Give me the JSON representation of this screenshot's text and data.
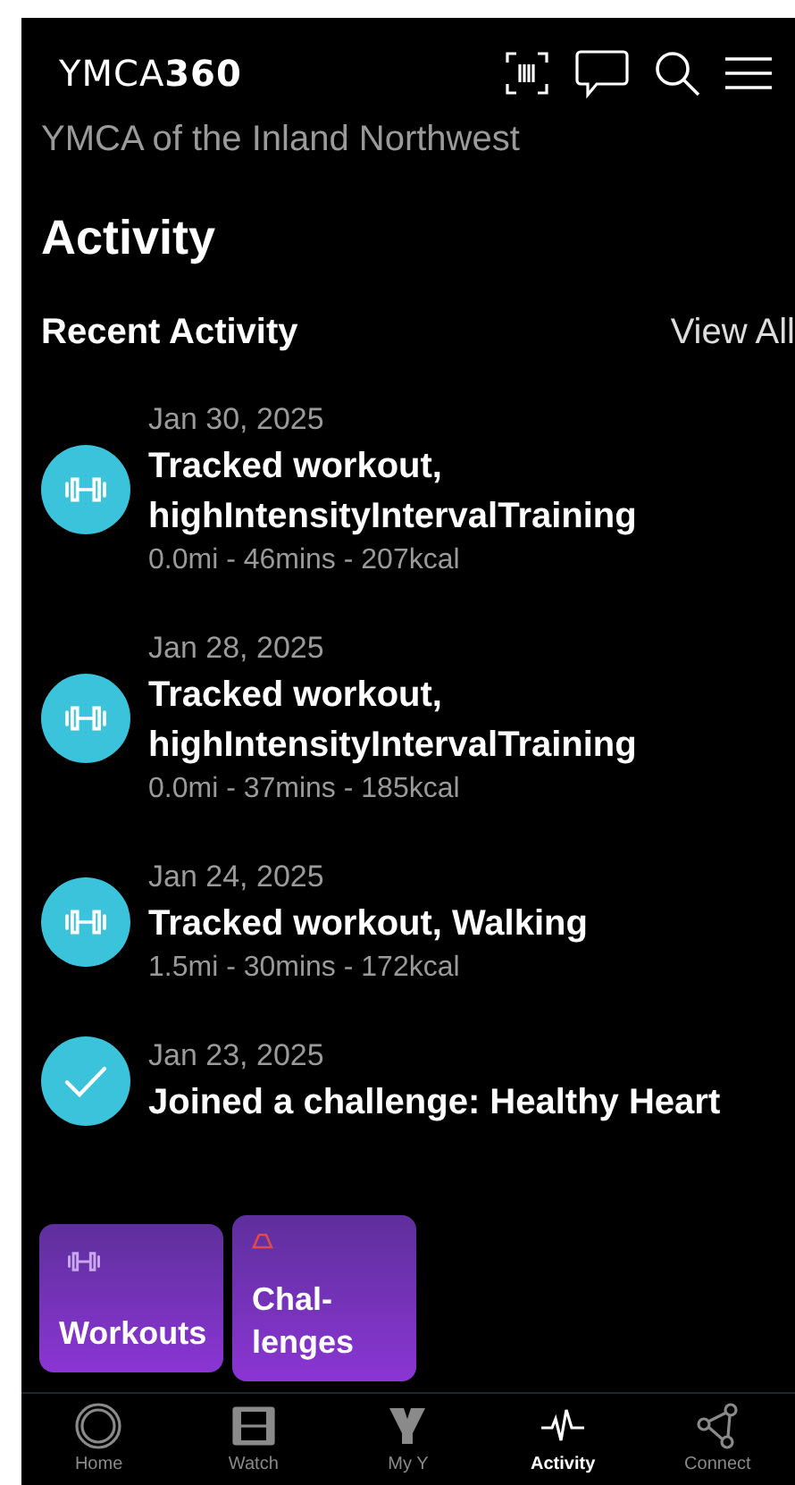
{
  "header": {
    "logo_text": "YMCA",
    "logo_number": "360",
    "subtitle": "YMCA of the Inland Northwest"
  },
  "page_title": "Activity",
  "section": {
    "title": "Recent Activity",
    "link": "View All"
  },
  "activities": [
    {
      "kind": "workout",
      "date": "Jan 30, 2025",
      "title": "Tracked workout, highIntensityIntervalTraining",
      "stats": "0.0mi - 46mins - 207kcal"
    },
    {
      "kind": "workout",
      "date": "Jan 28, 2025",
      "title": "Tracked workout, highIntensityIntervalTraining",
      "stats": "0.0mi - 37mins - 185kcal"
    },
    {
      "kind": "workout",
      "date": "Jan 24, 2025",
      "title": "Tracked workout, Walking",
      "stats": "1.5mi - 30mins - 172kcal"
    },
    {
      "kind": "challenge",
      "date": "Jan 23, 2025",
      "title": "Joined a challenge: Healthy Heart"
    }
  ],
  "tiles": [
    {
      "kind": "workouts",
      "label": "Workouts"
    },
    {
      "kind": "challenges",
      "label": "Chal-\nlenges"
    }
  ],
  "tabs": [
    {
      "kind": "home",
      "label": "Home",
      "selected": false
    },
    {
      "kind": "watch",
      "label": "Watch",
      "selected": false
    },
    {
      "kind": "myy",
      "label": "My Y",
      "selected": false
    },
    {
      "kind": "activity",
      "label": "Activity",
      "selected": true
    },
    {
      "kind": "connect",
      "label": "Connect",
      "selected": false
    }
  ]
}
